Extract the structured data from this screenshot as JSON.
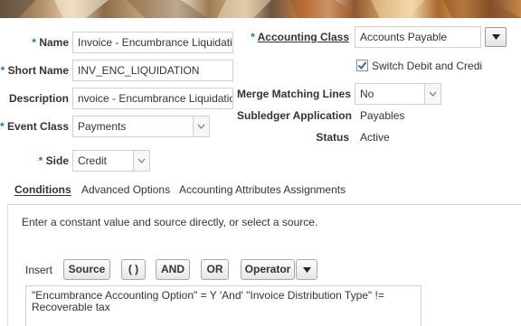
{
  "colors": {
    "required_star": "#2b6fb6",
    "label_text": "#333333",
    "border": "#cfcfcf",
    "checkbox_check": "#2b6fb6"
  },
  "form": {
    "name": {
      "label": "Name",
      "value": "Invoice - Encumbrance Liquidatio"
    },
    "short_name": {
      "label": "Short Name",
      "value": "INV_ENC_LIQUIDATION"
    },
    "description": {
      "label": "Description",
      "value": "nvoice - Encumbrance Liquidation"
    },
    "event_class": {
      "label": "Event Class",
      "value": "Payments"
    },
    "side": {
      "label": "Side",
      "value": "Credit"
    },
    "accounting_class": {
      "label": "Accounting Class",
      "value": "Accounts Payable"
    },
    "switch_debit_credit": {
      "label": "Switch Debit and Credi",
      "checked": true
    },
    "merge_matching_lines": {
      "label": "Merge Matching Lines",
      "value": "No"
    },
    "subledger_application": {
      "label": "Subledger Application",
      "value": "Payables"
    },
    "status": {
      "label": "Status",
      "value": "Active"
    },
    "required_marker": "*"
  },
  "tabs": [
    {
      "label": "Conditions",
      "active": true
    },
    {
      "label": "Advanced Options",
      "active": false
    },
    {
      "label": "Accounting Attributes Assignments",
      "active": false
    }
  ],
  "conditions": {
    "instruction": "Enter a constant value and source directly, or select a source.",
    "insert_label": "Insert",
    "buttons": {
      "source": "Source",
      "parens": "( )",
      "and": "AND",
      "or": "OR",
      "operator": "Operator"
    },
    "expression_line1": "\"Encumbrance Accounting Option\" = Y 'And' \"Invoice Distribution Type\" !=",
    "expression_line2": "Recoverable tax"
  },
  "icons": {
    "dropdown": "chevron-down-icon",
    "checkbox": "checkmark-icon",
    "operator_menu": "triangle-down-icon"
  }
}
